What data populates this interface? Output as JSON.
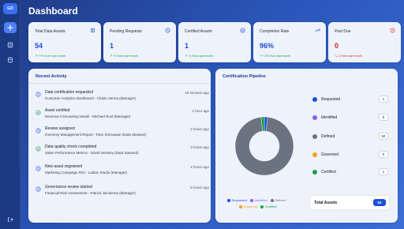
{
  "rail": {
    "logo": "GO",
    "items": [
      {
        "icon": "plus-icon"
      },
      {
        "icon": "list-icon"
      },
      {
        "icon": "database-icon"
      },
      {
        "icon": "logout-icon"
      }
    ]
  },
  "page": {
    "title": "Dashboard"
  },
  "stats": [
    {
      "label": "Total Data Assets",
      "value": "54",
      "trend": "↗ +7% from last month",
      "icon": "book-icon",
      "color": "#1d4ed8"
    },
    {
      "label": "Pending Requests",
      "value": "1",
      "trend": "↗ +1 from last month",
      "icon": "clock-icon",
      "color": "#1d4ed8"
    },
    {
      "label": "Certified Assets",
      "value": "1",
      "trend": "↗ +1 from last month",
      "icon": "check-circle-icon",
      "color": "#1d4ed8"
    },
    {
      "label": "Completion Rate",
      "value": "96%",
      "trend": "↗ +2% from last month",
      "icon": "trending-up-icon",
      "color": "#1d4ed8"
    },
    {
      "label": "Past Due",
      "value": "0",
      "trend": "↘ -2 from last month",
      "icon": "alert-circle-icon",
      "color": "#dc2626"
    }
  ],
  "activity": {
    "title": "Recent Activity",
    "items": [
      {
        "title": "Data certification requested",
        "detail": "Customer Analytics Dashboard - Chaitu Verma (Manager)",
        "time": "15 minutes ago",
        "icon": "clock-icon"
      },
      {
        "title": "Asset certified",
        "detail": "Revenue Forecasting Model - Michael Roof (Manager)",
        "time": "1 hour ago",
        "icon": "check-circle-icon"
      },
      {
        "title": "Review assigned",
        "detail": "Inventory Management Report - Ram Srinivasan (Data Steward)",
        "time": "2 hours ago",
        "icon": "clock-icon"
      },
      {
        "title": "Data quality check completed",
        "detail": "Sales Performance Metrics - David Hensley (Data Steward)",
        "time": "3 hours ago",
        "icon": "check-circle-icon"
      },
      {
        "title": "New asset registered",
        "detail": "Marketing Campaign ROI - Ladtoc Studio (Manager)",
        "time": "4 hours ago",
        "icon": "clock-icon"
      },
      {
        "title": "Governance review started",
        "detail": "Financial Risk Assessment - Patrick Jacolenne (Manager)",
        "time": "5 hours ago",
        "icon": "clock-icon"
      }
    ]
  },
  "pipeline": {
    "title": "Certification Pipeline",
    "stages": [
      {
        "name": "Requested",
        "count": 1,
        "color": "#1d4ed8"
      },
      {
        "name": "Identified",
        "count": 0,
        "color": "#8b5cf6"
      },
      {
        "name": "Defined",
        "count": 52,
        "color": "#6b7280"
      },
      {
        "name": "Governed",
        "count": 0,
        "color": "#f59e0b"
      },
      {
        "name": "Certified",
        "count": 1,
        "color": "#16a34a"
      }
    ],
    "total_label": "Total Assets",
    "total_value": "54"
  }
}
